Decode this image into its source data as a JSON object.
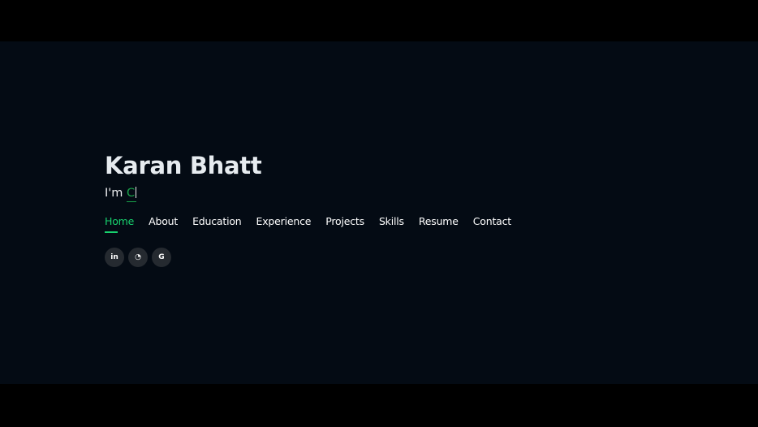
{
  "hero": {
    "name": "Karan Bhatt",
    "tagline_prefix": "I'm ",
    "typed_text": "C"
  },
  "nav": {
    "items": [
      {
        "label": "Home",
        "active": true
      },
      {
        "label": "About",
        "active": false
      },
      {
        "label": "Education",
        "active": false
      },
      {
        "label": "Experience",
        "active": false
      },
      {
        "label": "Projects",
        "active": false
      },
      {
        "label": "Skills",
        "active": false
      },
      {
        "label": "Resume",
        "active": false
      },
      {
        "label": "Contact",
        "active": false
      }
    ]
  },
  "social": {
    "links": [
      {
        "icon": "linkedin-icon",
        "glyph": "in"
      },
      {
        "icon": "github-icon",
        "glyph": "◔"
      },
      {
        "icon": "google-icon",
        "glyph": "G"
      }
    ]
  },
  "colors": {
    "background": "#040b14",
    "accent": "#18d26e",
    "text": "#ffffff",
    "social_bg": "#252a30"
  }
}
